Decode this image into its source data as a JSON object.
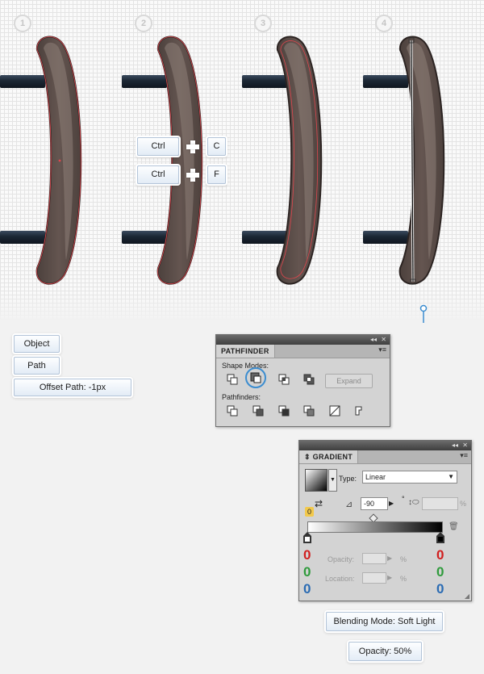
{
  "steps": [
    "1",
    "2",
    "3",
    "4"
  ],
  "shortcuts": [
    {
      "modifier": "Ctrl",
      "key": "C"
    },
    {
      "modifier": "Ctrl",
      "key": "F"
    }
  ],
  "menu_path": {
    "item1": "Object",
    "item2": "Path",
    "item3": "Offset Path: -1px"
  },
  "pathfinder": {
    "tab": "PATHFINDER",
    "shape_modes_label": "Shape Modes:",
    "expand_label": "Expand",
    "pathfinders_label": "Pathfinders:",
    "active_shape_mode": "minus-front"
  },
  "gradient": {
    "tab": "GRADIENT",
    "type_label": "Type:",
    "type_value": "Linear",
    "angle_value": "-90",
    "degree_symbol": "°",
    "percent_symbol": "%",
    "opacity_label": "Opacity:",
    "location_label": "Location:",
    "stop_left": {
      "r": "0",
      "g": "0",
      "b": "0"
    },
    "stop_right": {
      "r": "0",
      "g": "0",
      "b": "0"
    },
    "reverse_value": "0",
    "start_color": "#ffffff",
    "end_color": "#000000"
  },
  "notes": {
    "blending": "Blending Mode: Soft Light",
    "opacity": "Opacity: 50%"
  },
  "colors": {
    "handle": "#5f514c",
    "handle_dark": "#3c3230",
    "bar": "#1e2a38",
    "accent_blue": "#3c8dd0",
    "rgb_red": "#d11f1f",
    "rgb_green": "#2f9b3c",
    "rgb_blue": "#2a6bb3"
  }
}
